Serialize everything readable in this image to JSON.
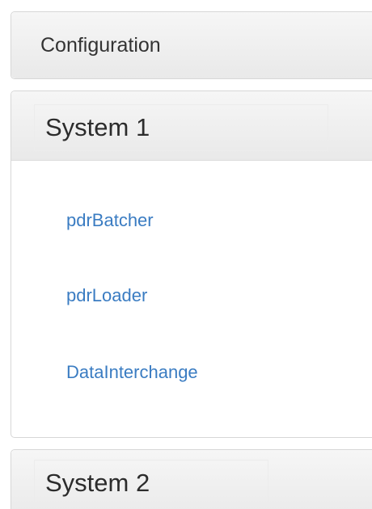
{
  "config_panel": {
    "title": "Configuration"
  },
  "system1": {
    "title": "System 1",
    "links": [
      {
        "label": "pdrBatcher"
      },
      {
        "label": "pdrLoader"
      },
      {
        "label": "DataInterchange"
      }
    ]
  },
  "system2": {
    "title": "System 2"
  },
  "colors": {
    "link": "#3a7cc2",
    "heading_bg": "#eeeeee",
    "border": "#d7d7d7"
  }
}
